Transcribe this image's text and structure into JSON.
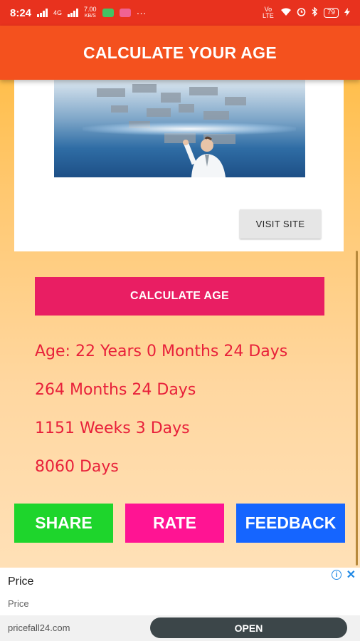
{
  "status_bar": {
    "time": "8:24",
    "network_label": "4G",
    "data_speed_value": "7.00",
    "data_speed_unit": "KB/S",
    "more": "···",
    "volte_label": "Vo LTE",
    "battery": "79",
    "icons": [
      "signal-icon",
      "wifi-icon",
      "alarm-icon",
      "bluetooth-icon",
      "battery-icon",
      "charging-icon"
    ]
  },
  "header": {
    "title": "CALCULATE YOUR AGE",
    "color": "#f4511e"
  },
  "ad_card": {
    "visit_label": "VISIT SITE"
  },
  "calculate": {
    "label": "CALCULATE AGE",
    "color": "#e91e63"
  },
  "results": {
    "age": "Age: 22 Years 0 Months 24 Days",
    "months": "264 Months 24 Days",
    "weeks": "1151 Weeks 3 Days",
    "days": "8060 Days"
  },
  "actions": {
    "share": "SHARE",
    "rate": "RATE",
    "feedback": "FEEDBACK"
  },
  "bottom_ad": {
    "title": "Price",
    "subtitle": "Price",
    "domain": "pricefall24.com",
    "open_label": "OPEN"
  }
}
